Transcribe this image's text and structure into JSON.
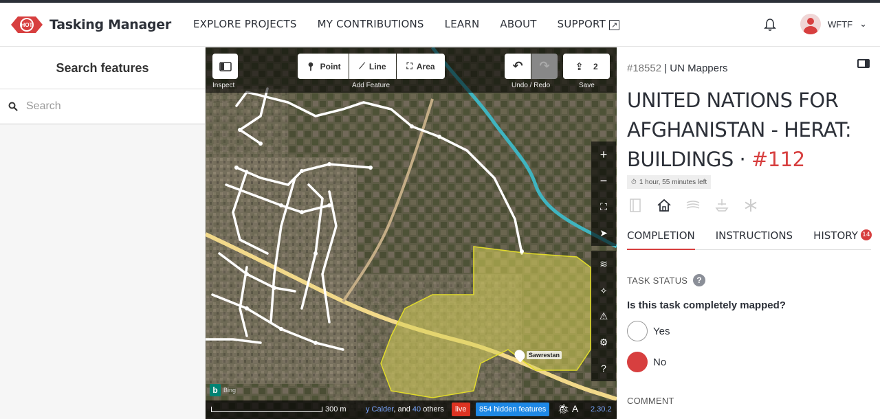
{
  "app": {
    "logo_badge": "HOT",
    "title": "Tasking Manager"
  },
  "nav": {
    "explore": "EXPLORE PROJECTS",
    "contributions": "MY CONTRIBUTIONS",
    "learn": "LEARN",
    "about": "ABOUT",
    "support": "SUPPORT"
  },
  "user": {
    "name": "WFTF"
  },
  "left_panel": {
    "title": "Search features",
    "search_placeholder": "Search"
  },
  "map": {
    "toolbar": {
      "inspect_label": "Inspect",
      "point": "Point",
      "line": "Line",
      "area": "Area",
      "add_feature_label": "Add Feature",
      "undo_redo_label": "Undo / Redo",
      "save_count": "2",
      "save_label": "Save"
    },
    "poi_label": "Sawrestan",
    "bing_label": "Bing",
    "footer": {
      "scale": "300 m",
      "attribution_user": "y Calder",
      "attribution_and": ", and ",
      "attribution_count": "40",
      "attribution_others": " others",
      "live": "live",
      "hidden_features": "854 hidden features",
      "version": "2.30.2"
    }
  },
  "task": {
    "project_id": "#18552",
    "organisation": "| UN Mappers",
    "title_main": "UNITED NATIONS FOR AFGHANISTAN - HERAT: BUILDINGS · ",
    "task_number": "#112",
    "time_left": "1 hour, 55 minutes left",
    "tabs": {
      "completion": "COMPLETION",
      "instructions": "INSTRUCTIONS",
      "history": "HISTORY",
      "history_count": "14"
    },
    "status_label": "TASK STATUS",
    "help_mark": "?",
    "question": "Is this task completely mapped?",
    "yes": "Yes",
    "no": "No",
    "comment_label": "COMMENT"
  },
  "colors": {
    "accent": "#d73f3f",
    "text": "#2c3038",
    "hidden_badge": "#1e88e5"
  }
}
